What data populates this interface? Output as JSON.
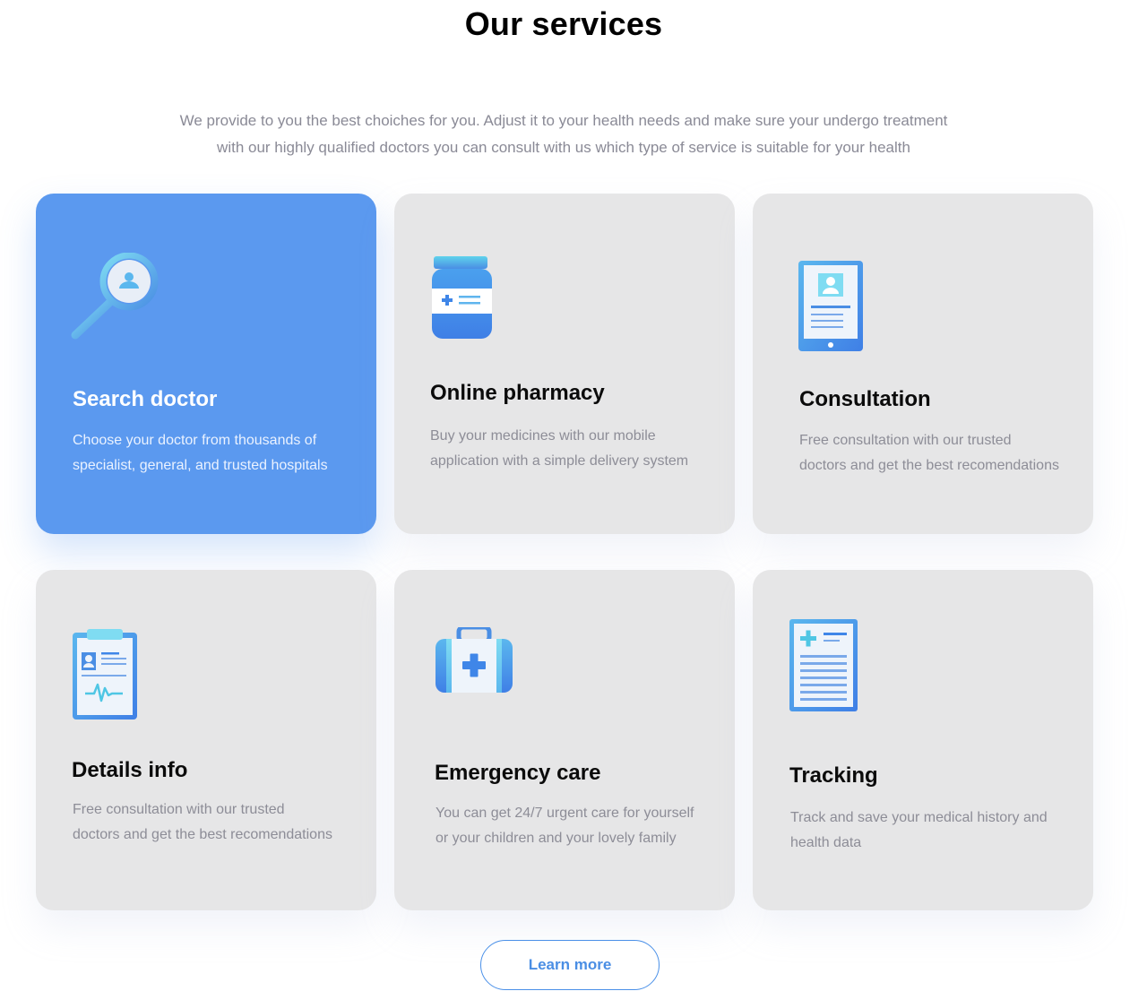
{
  "header": {
    "title": "Our services",
    "subtitle_line1": "We provide to you the best choiches for you. Adjust it to your health needs and make sure your undergo treatment",
    "subtitle_line2": "with our highly qualified doctors you can consult with us which type of service is suitable for your health"
  },
  "services": [
    {
      "title": "Search doctor",
      "description": "Choose your doctor from thousands of specialist, general, and trusted hospitals",
      "icon": "magnifier-doctor-icon",
      "active": true
    },
    {
      "title": "Online pharmacy",
      "description": "Buy  your medicines with our mobile application with a simple delivery system",
      "icon": "medicine-bottle-icon",
      "active": false
    },
    {
      "title": "Consultation",
      "description": "Free consultation with our trusted doctors and get the best recomendations",
      "icon": "tablet-profile-icon",
      "active": false
    },
    {
      "title": "Details info",
      "description": "Free consultation with our trusted doctors and get the best recomendations",
      "icon": "clipboard-heartbeat-icon",
      "active": false
    },
    {
      "title": "Emergency care",
      "description": "You can get 24/7 urgent care for yourself or your children and your lovely family",
      "icon": "first-aid-kit-icon",
      "active": false
    },
    {
      "title": "Tracking",
      "description": "Track and save your medical history and health data",
      "icon": "medical-document-icon",
      "active": false
    }
  ],
  "cta": {
    "label": "Learn more"
  },
  "colors": {
    "accent": "#5b99ef",
    "card_bg": "#e6e6e7",
    "icon_blue": "#4a8ee4",
    "icon_cyan": "#5fd3ec"
  }
}
